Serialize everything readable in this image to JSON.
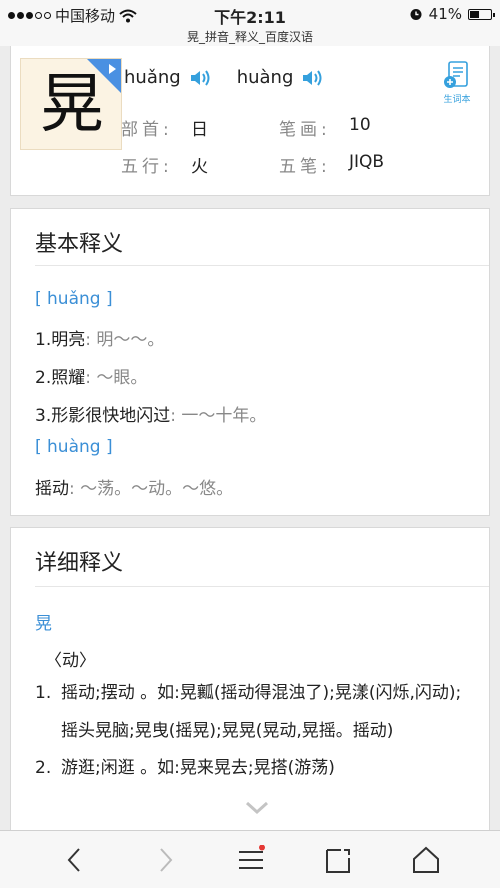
{
  "status": {
    "carrier": "中国移动",
    "time": "下午2:11",
    "battery": "41%",
    "battery_level": 0.41
  },
  "page_title": "晃_拼音_释义_百度汉语",
  "entry": {
    "character": "晃",
    "readings": [
      {
        "pinyin": "huǎng",
        "icon": "speaker-icon"
      },
      {
        "pinyin": "huàng",
        "icon": "speaker-icon"
      }
    ],
    "bushou_label": "部首:",
    "bushou": "日",
    "bihua_label": "笔画:",
    "bihua": "10",
    "wuxing_label": "五行:",
    "wuxing": "火",
    "wubi_label": "五笔:",
    "wubi": "JIQB",
    "wordbook_label": "生词本"
  },
  "basic": {
    "title": "基本释义",
    "reading1": "[ huǎng ]",
    "defs1": [
      {
        "text": "1.明亮",
        "example": ": 明～～。"
      },
      {
        "text": "2.照耀",
        "example": ": ～眼。"
      },
      {
        "text": "3.形影很快地闪过",
        "example": ": 一～十年。"
      }
    ],
    "reading2": "[ huàng ]",
    "defs2": [
      {
        "text": "摇动",
        "example": ": ～荡。～动。～悠。"
      }
    ]
  },
  "detail": {
    "title": "详细释义",
    "char": "晃",
    "pos": "〈动〉",
    "items": [
      {
        "num": "1.",
        "text": "摇动;摆动 。如:晃瓤(摇动得混浊了);晃漾(闪烁,闪动);摇头晃脑;晃曳(摇晃);晃晃(晃动,晃摇。摇动)"
      },
      {
        "num": "2.",
        "text": "游逛;闲逛 。如:晃来晃去;晃搭(游荡)"
      }
    ]
  },
  "colors": {
    "accent": "#3b8fd6",
    "play_badge": "#4a90e2",
    "speaker": "#35a0dd",
    "muted": "#888888"
  }
}
